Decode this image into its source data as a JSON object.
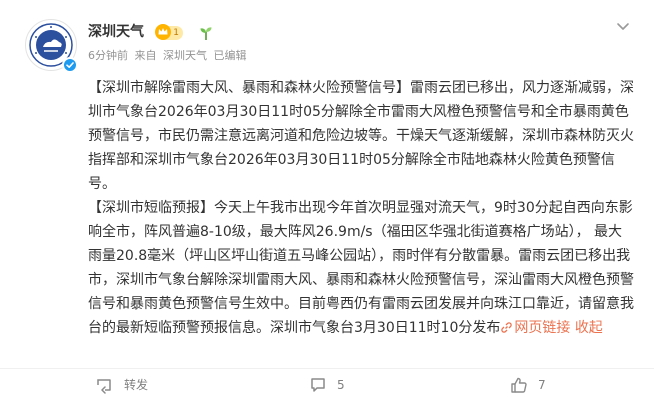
{
  "account": {
    "name": "深圳天气",
    "vip_level": "1"
  },
  "meta": {
    "time": "6分钟前",
    "source_prefix": "来自",
    "source": "深圳天气",
    "edited": "已编辑"
  },
  "post": {
    "p1_title": "【深圳市解除雷雨大风、暴雨和森林火险预警信号】",
    "p1_text": "雷雨云团已移出，风力逐渐减弱，深圳市气象台2026年03月30日11时05分解除全市雷雨大风橙色预警信号和全市暴雨黄色预警信号，市民仍需注意远离河道和危险边坡等。干燥天气逐渐缓解，深圳市森林防灭火指挥部和深圳市气象台2026年03月30日11时05分解除全市陆地森林火险黄色预警信号。",
    "p2_title": "【深圳市短临预报】",
    "p2_text": "今天上午我市出现今年首次明显强对流天气，9时30分起自西向东影响全市，阵风普遍8-10级，最大阵风26.9m/s（福田区华强北街道赛格广场站），  最大雨量20.8毫米（坪山区坪山街道五马峰公园站），雨时伴有分散雷暴。雷雨云团已移出我市，深圳市气象台解除深圳雷雨大风、暴雨和森林火险预警信号，深汕雷雨大风橙色预警信号和暴雨黄色预警信号生效中。目前粤西仍有雷雨云团发展并向珠江口靠近，请留意我台的最新短临预警预报信息。深圳市气象台3月30日11时10分发布",
    "web_link": "网页链接",
    "collapse": "收起"
  },
  "actions": {
    "repost_label": "转发",
    "comment_count": "5",
    "like_count": "7"
  },
  "colors": {
    "link": "#eb7350",
    "verified": "#1d9bf0",
    "vip": "#ffe9a6"
  },
  "icons": [
    "account-avatar",
    "verified-icon",
    "vip-crown-icon",
    "sprout-icon",
    "chevron-down-icon",
    "link-icon",
    "repost-icon",
    "comment-icon",
    "like-icon"
  ]
}
